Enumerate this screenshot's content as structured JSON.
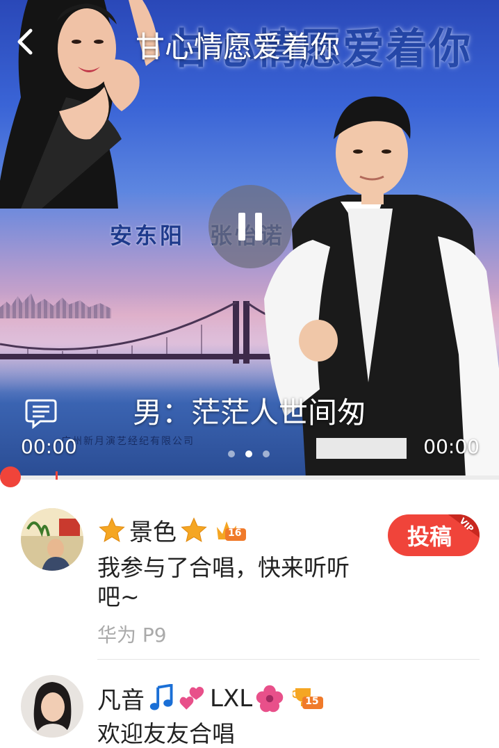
{
  "header": {
    "title": "甘心情愿爱着你"
  },
  "album_art": {
    "title_text": "甘心情愿爱着你",
    "singers": "安东阳　张怡诺",
    "company": "广州新月演艺经纪有限公司"
  },
  "player": {
    "current_lyric": "男：茫茫人世间匆",
    "elapsed_time": "00:00",
    "total_time": "00:00",
    "progress_fraction": 0.0,
    "state": "playing",
    "page_dots": 3,
    "active_page": 2
  },
  "comments": [
    {
      "name": "景色",
      "level": "16",
      "text": "我参与了合唱，快来听听吧~",
      "device": "华为 P9",
      "action_label": "投稿",
      "action_badge": "VIP"
    },
    {
      "name": "凡音",
      "name_suffix": "LXL",
      "level": "15",
      "text": "欢迎友友合唱"
    }
  ],
  "colors": {
    "accent": "#f0443a",
    "text_primary": "#222222",
    "text_secondary": "#aaaaaa",
    "star": "#f5a623",
    "music_note": "#1a6fd6",
    "hearts": "#e8508a",
    "flower": "#e8508a"
  },
  "icons": {
    "back": "chevron-left-icon",
    "pause": "pause-icon",
    "lyrics": "lyrics-icon",
    "star": "star-icon",
    "crown": "crown-level-icon",
    "trophy": "trophy-level-icon"
  }
}
